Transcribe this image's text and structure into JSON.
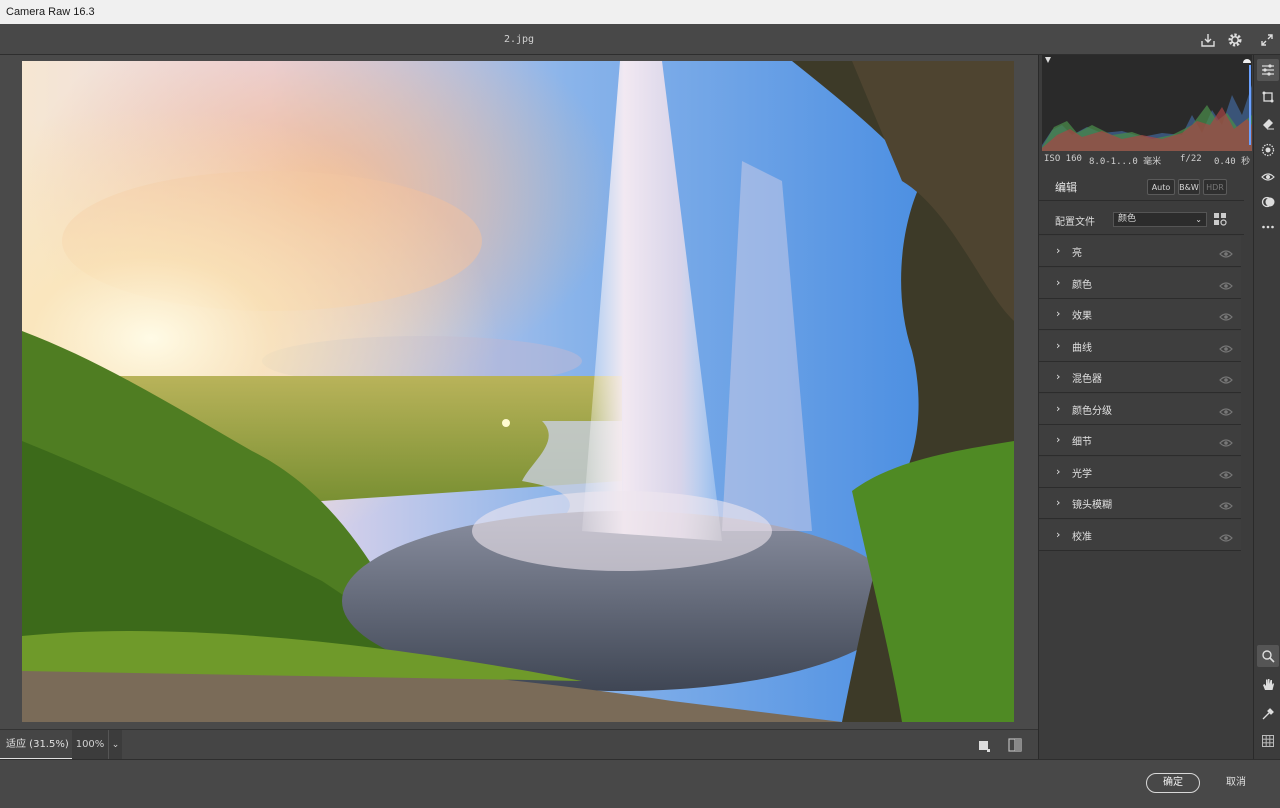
{
  "window": {
    "title": "Camera Raw 16.3"
  },
  "file": {
    "name": "2.jpg"
  },
  "header_icons": [
    "save-icon",
    "gear-icon",
    "fullscreen-icon"
  ],
  "exif": {
    "iso": "ISO 160",
    "lens": "8.0-1...0 毫米",
    "aperture": "f/22",
    "shutter": "0.40 秒"
  },
  "edit": {
    "title": "编辑",
    "modes": {
      "auto": "Auto",
      "bw": "B&W",
      "hdr": "HDR"
    }
  },
  "profile": {
    "label": "配置文件",
    "value": "颜色"
  },
  "sections": [
    {
      "label": "亮"
    },
    {
      "label": "颜色"
    },
    {
      "label": "效果"
    },
    {
      "label": "曲线"
    },
    {
      "label": "混色器"
    },
    {
      "label": "颜色分级"
    },
    {
      "label": "细节"
    },
    {
      "label": "光学"
    },
    {
      "label": "镜头模糊"
    },
    {
      "label": "校准"
    }
  ],
  "viewbar": {
    "fit": "适应 (31.5%)",
    "zoom": "100%"
  },
  "footer": {
    "ok": "确定",
    "cancel": "取消"
  },
  "colors": {
    "panel": "#3c3c3c",
    "viewer": "#4a4a4a",
    "titlebar": "#f0f0f0"
  }
}
